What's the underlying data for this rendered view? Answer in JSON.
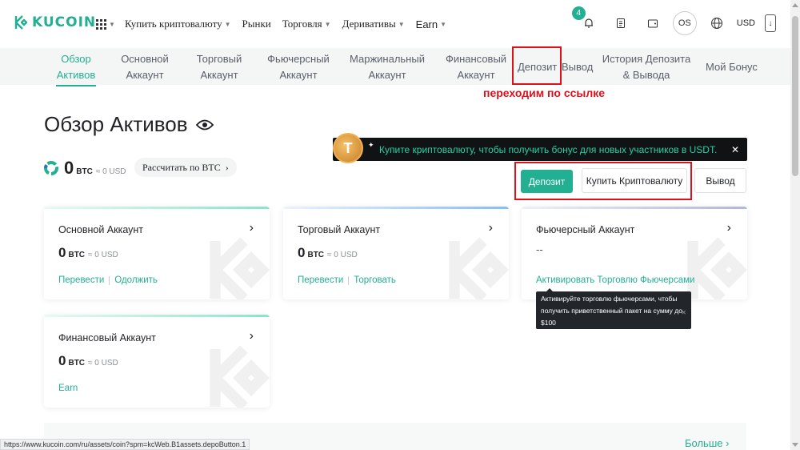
{
  "header": {
    "logo_text": "KUCOIN",
    "nav": [
      {
        "label": "Купить криптовалюту",
        "dropdown": true
      },
      {
        "label": "Рынки",
        "dropdown": false
      },
      {
        "label": "Торговля",
        "dropdown": true
      },
      {
        "label": "Деривативы",
        "dropdown": true
      },
      {
        "label": "Earn",
        "dropdown": true
      }
    ],
    "notification_count": "4",
    "avatar_initials": "OS",
    "currency": "USD"
  },
  "subnav": {
    "tabs": [
      {
        "label": "Обзор Активов",
        "active": true
      },
      {
        "label": "Основной Аккаунт"
      },
      {
        "label": "Торговый Аккаунт"
      },
      {
        "label": "Фьючерсный Аккаунт"
      },
      {
        "label": "Маржинальный Аккаунт"
      },
      {
        "label": "Финансовый Аккаунт"
      },
      {
        "label": "Депозит"
      },
      {
        "label": "Вывод"
      },
      {
        "label": "История Депозита & Вывода"
      },
      {
        "label": "Мой Бонус"
      }
    ]
  },
  "annotation": "переходим по ссылке",
  "page_title": "Обзор Активов",
  "balance": {
    "value": "0",
    "unit": "BTC",
    "approx": "≈ 0 USD",
    "calc_label": "Рассчитать по BTC"
  },
  "promo": {
    "text": "Купите криптовалюту, чтобы получить бонус для новых участников в USDT.",
    "coin_letter": "T"
  },
  "actions": {
    "deposit": "Депозит",
    "buy": "Купить Криптовалюту",
    "withdraw": "Вывод"
  },
  "cards": {
    "main": {
      "title": "Основной Аккаунт",
      "value": "0",
      "unit": "BTC",
      "approx": "≈ 0 USD",
      "link1": "Перевести",
      "link2": "Одолжить"
    },
    "trading": {
      "title": "Торговый Аккаунт",
      "value": "0",
      "unit": "BTC",
      "approx": "≈ 0 USD",
      "link1": "Перевести",
      "link2": "Торговать"
    },
    "futures": {
      "title": "Фьючерсный Аккаунт",
      "value": "--",
      "link1": "Активировать Торговлю Фьючерсами"
    },
    "finance": {
      "title": "Финансовый Аккаунт",
      "value": "0",
      "unit": "BTC",
      "approx": "≈ 0 USD",
      "link1": "Earn"
    }
  },
  "tooltip": {
    "text": "Активируйте торговлю фьючерсами, чтобы получить приветственный пакет на сумму до $100"
  },
  "more_label": "Больше",
  "status_url": "https://www.kucoin.com/ru/assets/coin?spm=kcWeb.B1assets.depoButton.1",
  "colors": {
    "accent": "#23af91",
    "annotation": "#e0101a",
    "promo_bg": "#101214"
  }
}
